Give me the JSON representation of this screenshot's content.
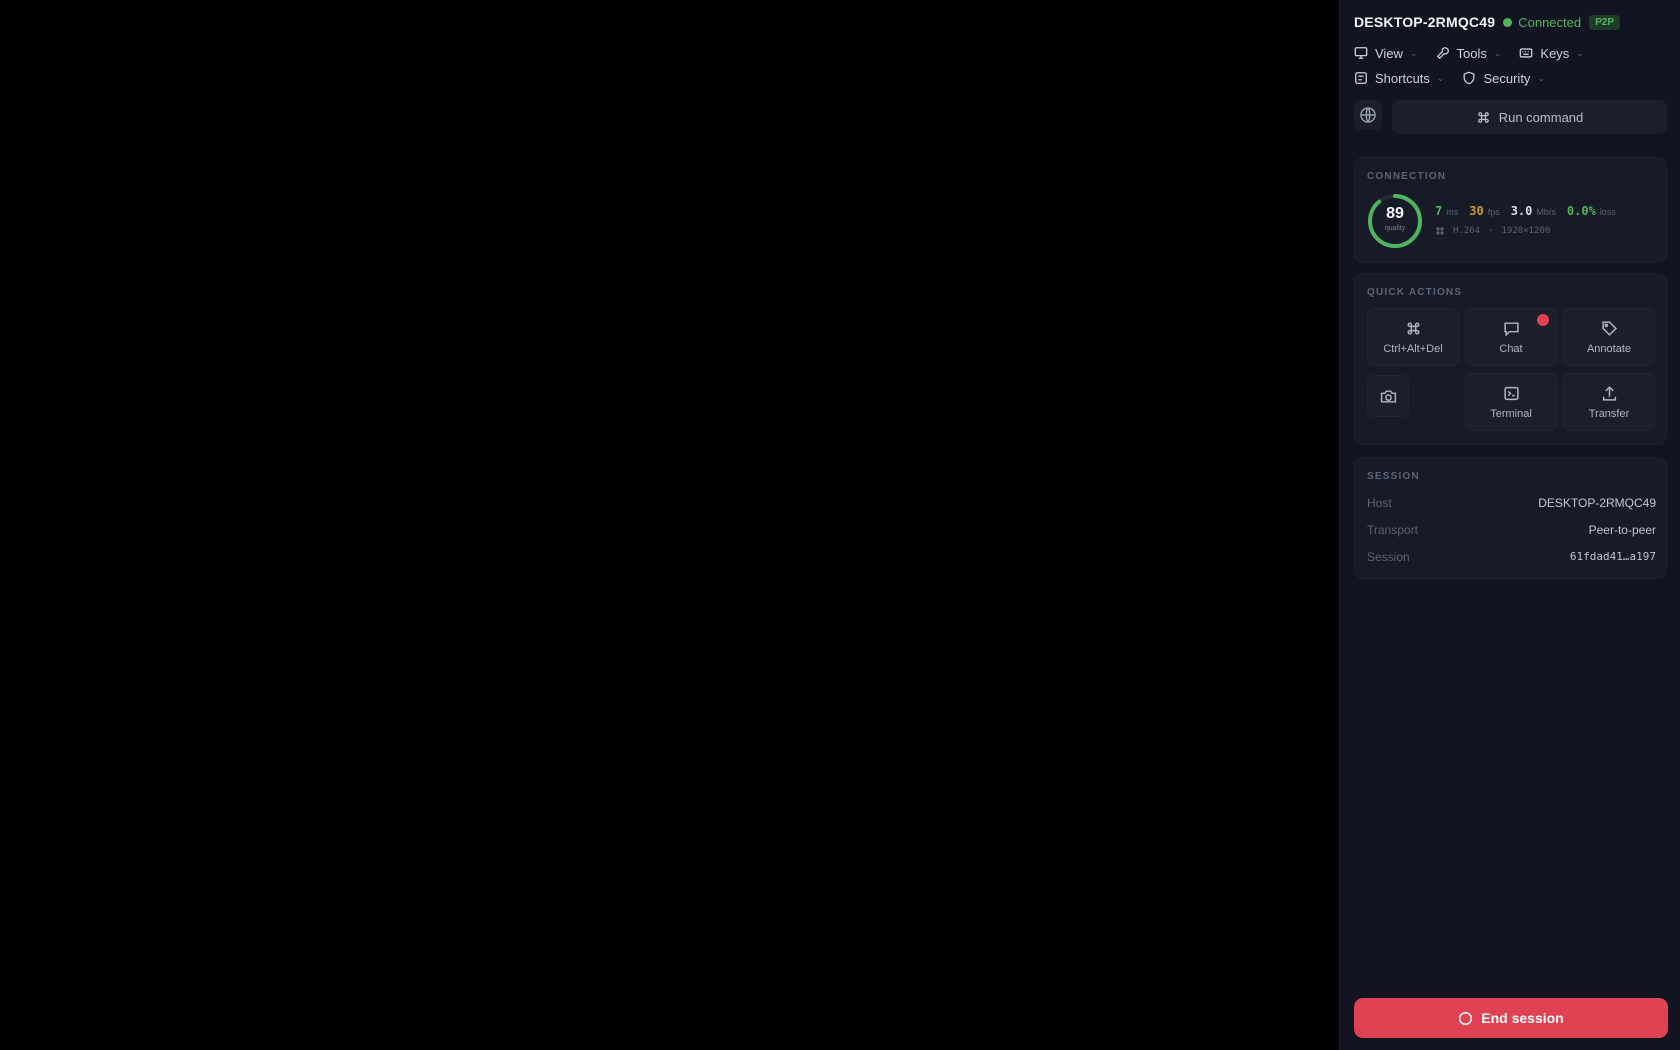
{
  "header": {
    "hostname": "DESKTOP-2RMQC49",
    "status": "Connected",
    "badge": "P2P",
    "status_color": "#4fb35f"
  },
  "menus": {
    "row1": [
      {
        "label": "View",
        "icon": "monitor-icon"
      },
      {
        "label": "Tools",
        "icon": "wrench-icon"
      },
      {
        "label": "Keys",
        "icon": "keyboard-icon"
      }
    ],
    "row2": [
      {
        "label": "Shortcuts",
        "icon": "command-icon"
      },
      {
        "label": "Security",
        "icon": "shield-icon"
      }
    ]
  },
  "command_bar": {
    "run_label": "Run command"
  },
  "connection": {
    "title": "CONNECTION",
    "quality": 0.89,
    "quality_value": "89",
    "quality_label": "quality",
    "stats": [
      {
        "value": "7",
        "unit": "ms",
        "color": "green"
      },
      {
        "value": "30",
        "unit": "fps",
        "color": "amber"
      },
      {
        "value": "3.0",
        "unit": "Mb/s",
        "color": "white"
      },
      {
        "value": "0.0%",
        "unit": "loss",
        "color": "green"
      }
    ],
    "codec": "H.264",
    "resolution": "1920×1200"
  },
  "quick_actions": {
    "title": "QUICK ACTIONS",
    "ctrl_alt_del": "Ctrl+Alt+Del",
    "chat": "Chat",
    "annotate": "Annotate",
    "terminal": "Terminal",
    "transfer": "Transfer"
  },
  "session": {
    "title": "SESSION",
    "host_label": "Host",
    "host_value": "DESKTOP-2RMQC49",
    "transport_label": "Transport",
    "transport_value": "Peer-to-peer",
    "session_label": "Session",
    "session_value": "61fdad41…a197"
  },
  "footer": {
    "end_label": "End session",
    "end_color": "#e04253"
  }
}
